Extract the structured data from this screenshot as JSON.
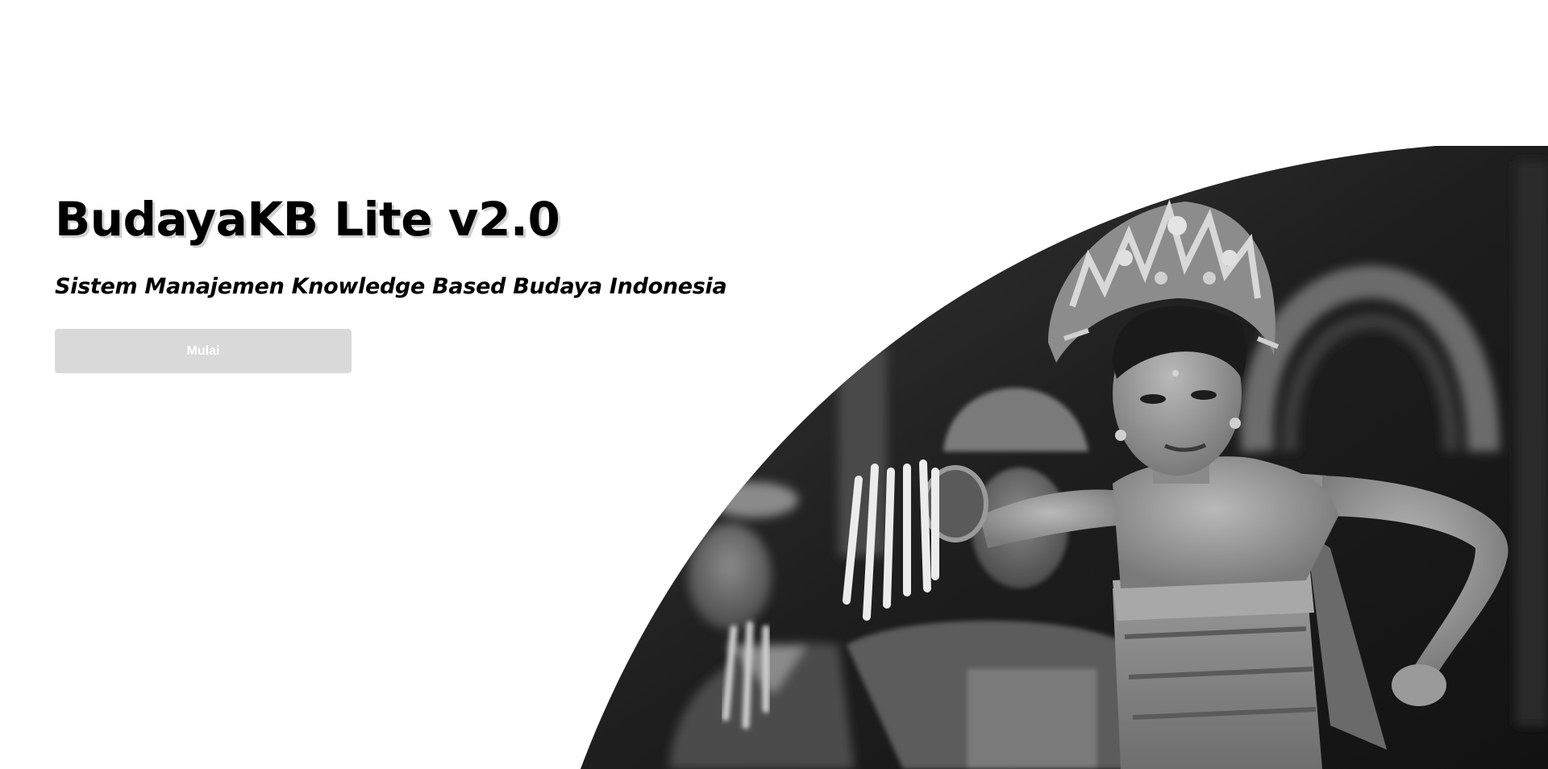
{
  "hero": {
    "title": "BudayaKB Lite v2.0",
    "subtitle": "Sistem Manajemen Knowledge Based Budaya Indonesia",
    "start_button_label": "Mulai"
  },
  "image": {
    "subject": "balinese-dancers-photo",
    "style": "grayscale"
  },
  "colors": {
    "background": "#ffffff",
    "text": "#000000",
    "button_bg": "#d9d9d9",
    "button_text": "#ffffff"
  }
}
